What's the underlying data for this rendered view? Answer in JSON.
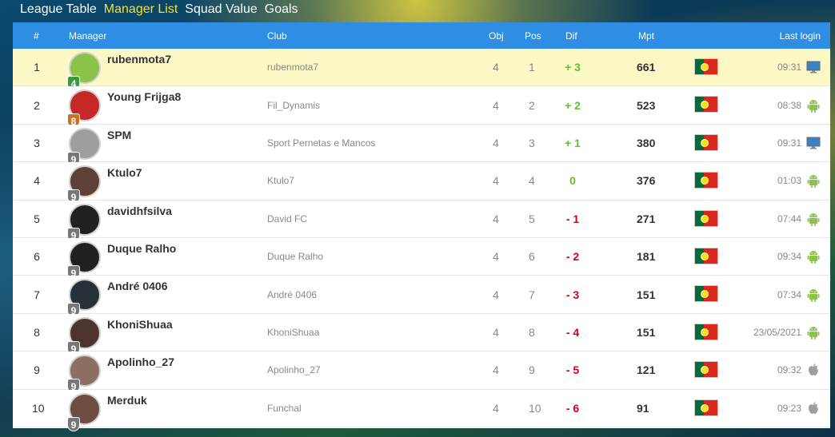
{
  "tabs": [
    {
      "label": "League Table",
      "active": false
    },
    {
      "label": "Manager List",
      "active": true
    },
    {
      "label": "Squad Value",
      "active": false
    },
    {
      "label": "Goals",
      "active": false
    }
  ],
  "header": {
    "rank": "#",
    "manager": "Manager",
    "club": "Club",
    "obj": "Obj",
    "pos": "Pos",
    "dif": "Dif",
    "mpt": "Mpt",
    "last_login": "Last login"
  },
  "colors": {
    "header_bg": "#2f8ee3",
    "highlight_row": "#fbf8c6",
    "dif_positive": "#5cc22b",
    "dif_negative": "#d0021b",
    "active_tab": "#f6e31a"
  },
  "rows": [
    {
      "rank": "1",
      "manager": "rubenmota7",
      "level": "4",
      "club": "rubenmota7",
      "obj": "4",
      "pos": "1",
      "dif": "+ 3",
      "mpt": "661",
      "login": "09:31",
      "device": "desktop-icon",
      "highlight": true
    },
    {
      "rank": "2",
      "manager": "Young Frijga8",
      "level": "8",
      "club": "Fil_Dynamis",
      "obj": "4",
      "pos": "2",
      "dif": "+ 2",
      "mpt": "523",
      "login": "08:38",
      "device": "android-icon",
      "highlight": false
    },
    {
      "rank": "3",
      "manager": "SPM",
      "level": "9",
      "club": "Sport Pernetas e Mancos",
      "obj": "4",
      "pos": "3",
      "dif": "+ 1",
      "mpt": "380",
      "login": "09:31",
      "device": "desktop-icon",
      "highlight": false
    },
    {
      "rank": "4",
      "manager": "Ktulo7",
      "level": "9",
      "club": "Ktulo7",
      "obj": "4",
      "pos": "4",
      "dif": "0",
      "mpt": "376",
      "login": "01:03",
      "device": "android-icon",
      "highlight": false
    },
    {
      "rank": "5",
      "manager": "davidhfsilva",
      "level": "9",
      "club": "David FC",
      "obj": "4",
      "pos": "5",
      "dif": "- 1",
      "mpt": "271",
      "login": "07:44",
      "device": "android-icon",
      "highlight": false
    },
    {
      "rank": "6",
      "manager": "Duque Ralho",
      "level": "9",
      "club": "Duque Ralho",
      "obj": "4",
      "pos": "6",
      "dif": "- 2",
      "mpt": "181",
      "login": "09:34",
      "device": "android-icon",
      "highlight": false
    },
    {
      "rank": "7",
      "manager": "André 0406",
      "level": "9",
      "club": "André 0406",
      "obj": "4",
      "pos": "7",
      "dif": "- 3",
      "mpt": "151",
      "login": "07:34",
      "device": "android-icon",
      "highlight": false
    },
    {
      "rank": "8",
      "manager": "KhoniShuaa",
      "level": "9",
      "club": "KhoniShuaa",
      "obj": "4",
      "pos": "8",
      "dif": "- 4",
      "mpt": "151",
      "login": "23/05/2021",
      "device": "android-icon",
      "highlight": false
    },
    {
      "rank": "9",
      "manager": "Apolinho_27",
      "level": "9",
      "club": "Apolinho_27",
      "obj": "4",
      "pos": "9",
      "dif": "- 5",
      "mpt": "121",
      "login": "09:32",
      "device": "apple-icon",
      "highlight": false
    },
    {
      "rank": "10",
      "manager": "Merduk",
      "level": "9",
      "club": "Funchal",
      "obj": "4",
      "pos": "10",
      "dif": "- 6",
      "mpt": "91",
      "login": "09:23",
      "device": "apple-icon",
      "highlight": false
    }
  ]
}
